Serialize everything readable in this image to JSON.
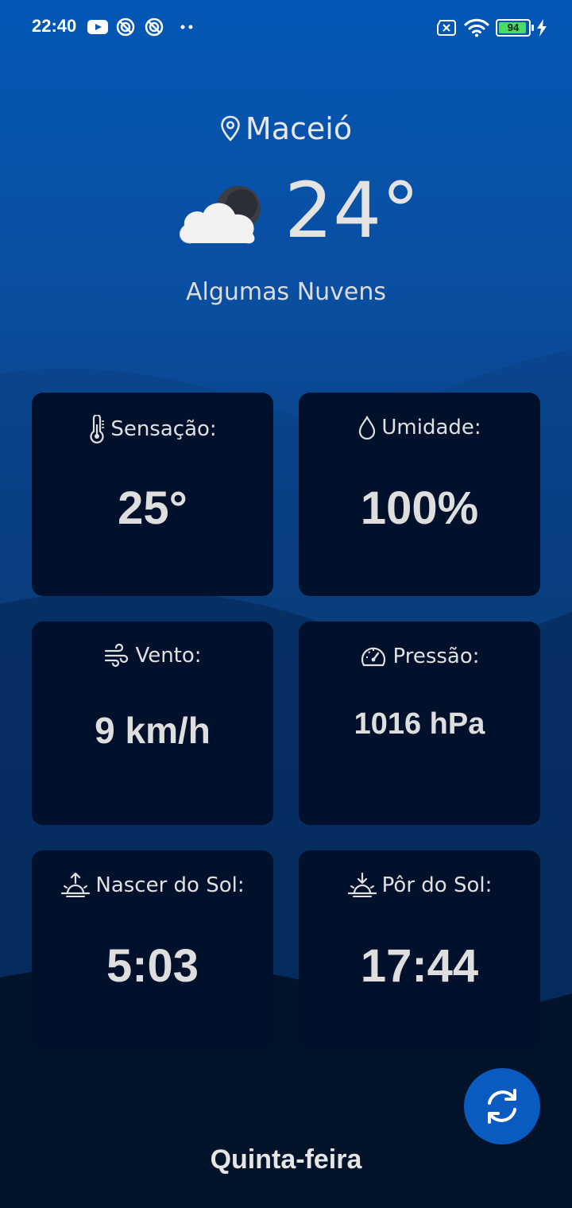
{
  "status_bar": {
    "time": "22:40",
    "battery_level": "94",
    "battery_fraction": 0.94,
    "icons": [
      "youtube-icon",
      "circle-slash-icon",
      "circle-slash-icon",
      "more-dots-icon",
      "no-sim-icon",
      "wifi-icon",
      "battery-icon",
      "charging-icon"
    ]
  },
  "location": {
    "name": "Maceió",
    "icon": "location-pin-icon"
  },
  "current": {
    "temperature": "24°",
    "condition": "Algumas Nuvens",
    "icon": "cloud-moon-icon"
  },
  "cards": {
    "feels_like": {
      "label": "Sensação:",
      "value": "25°",
      "icon": "thermometer-icon"
    },
    "humidity": {
      "label": "Umidade:",
      "value": "100%",
      "icon": "droplet-icon"
    },
    "wind": {
      "label": "Vento:",
      "value": "9 km/h",
      "icon": "wind-icon"
    },
    "pressure": {
      "label": "Pressão:",
      "value": "1016 hPa",
      "icon": "gauge-icon"
    },
    "sunrise": {
      "label": "Nascer do Sol:",
      "value": "5:03",
      "icon": "sunrise-icon"
    },
    "sunset": {
      "label": "Pôr do Sol:",
      "value": "17:44",
      "icon": "sunset-icon"
    }
  },
  "day": "Quinta-feira",
  "refresh": {
    "icon": "refresh-icon"
  },
  "colors": {
    "card_bg": "#02112b",
    "accent": "#0a5bc0",
    "text": "#e0e0e0"
  }
}
